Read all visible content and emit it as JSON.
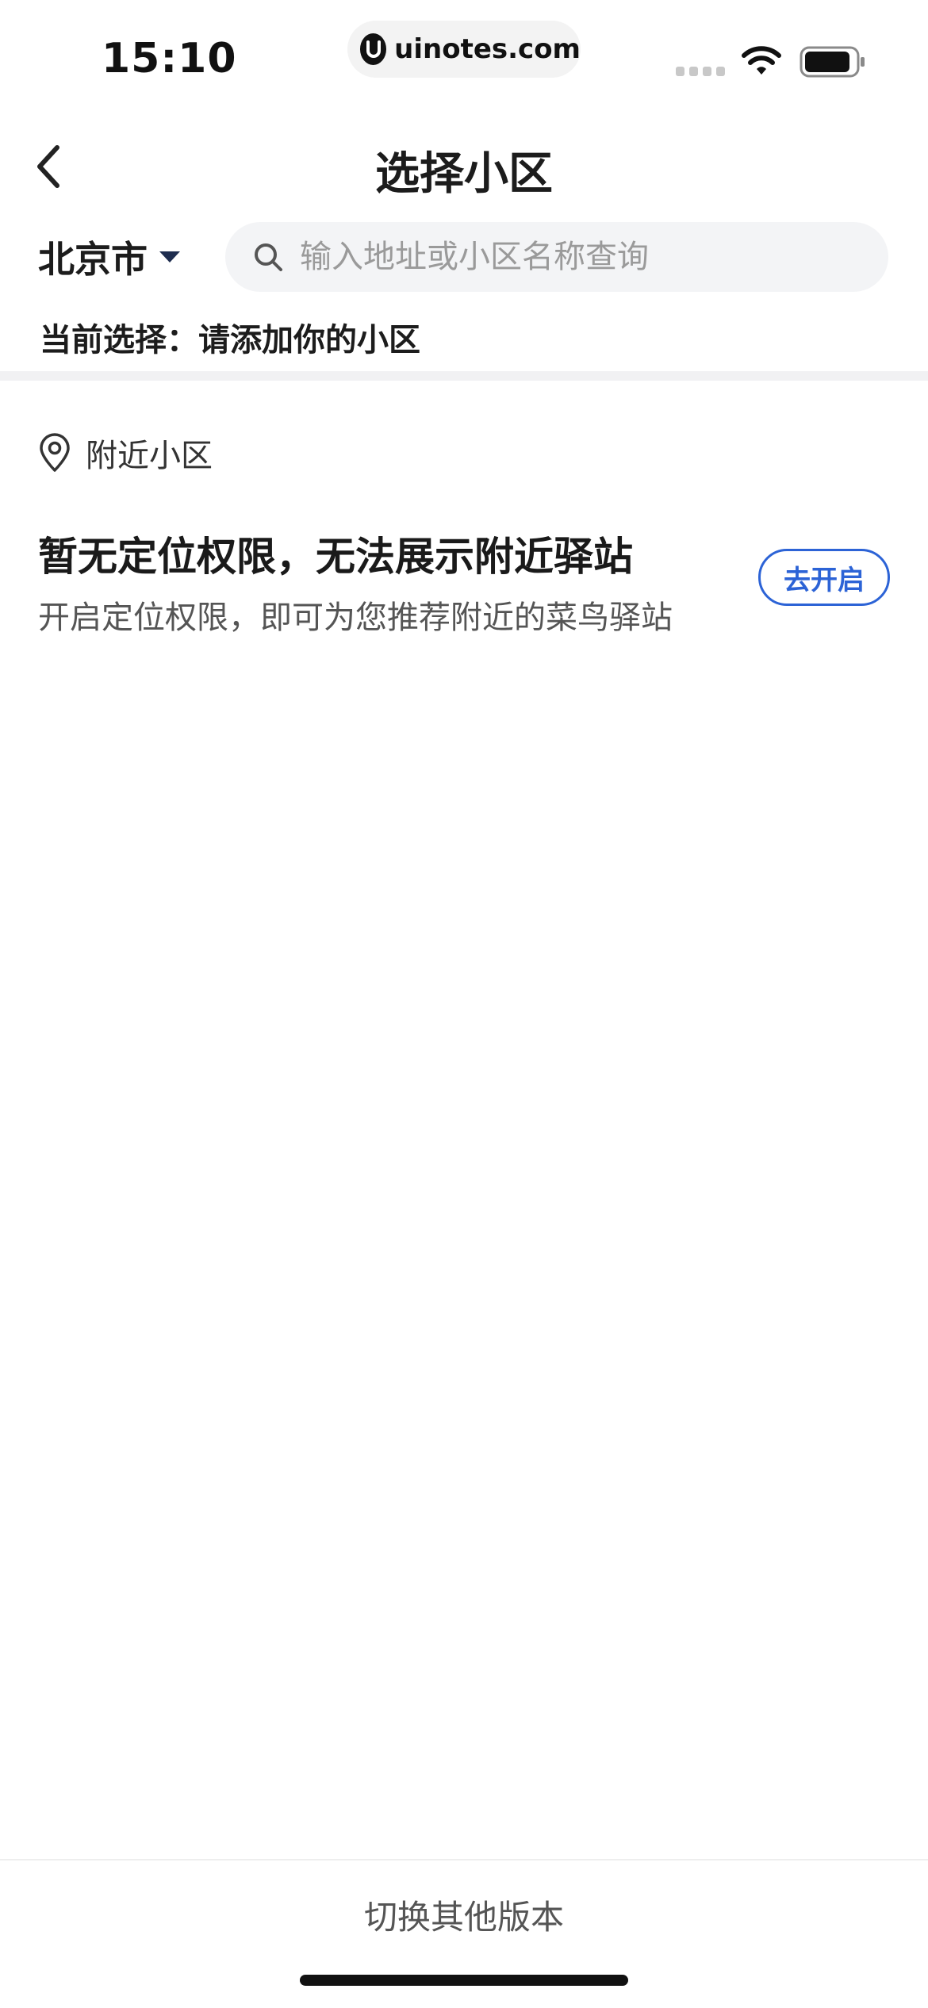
{
  "status_bar": {
    "time": "15:10",
    "url": "uinotes.com"
  },
  "nav": {
    "title": "选择小区",
    "back_icon": "chevron-left-icon"
  },
  "search_row": {
    "city": "北京市",
    "search_placeholder": "输入地址或小区名称查询"
  },
  "current_selection": {
    "label": "当前选择：",
    "value": "请添加你的小区"
  },
  "nearby": {
    "header_label": "附近小区",
    "permission_title": "暂无定位权限，无法展示附近驿站",
    "permission_desc": "开启定位权限，即可为您推荐附近的菜鸟驿站",
    "enable_button": "去开启"
  },
  "footer": {
    "switch_version": "切换其他版本"
  },
  "colors": {
    "accent": "#2c63d6",
    "search_bg": "#f3f4f6",
    "divider": "#f1f1f3"
  }
}
